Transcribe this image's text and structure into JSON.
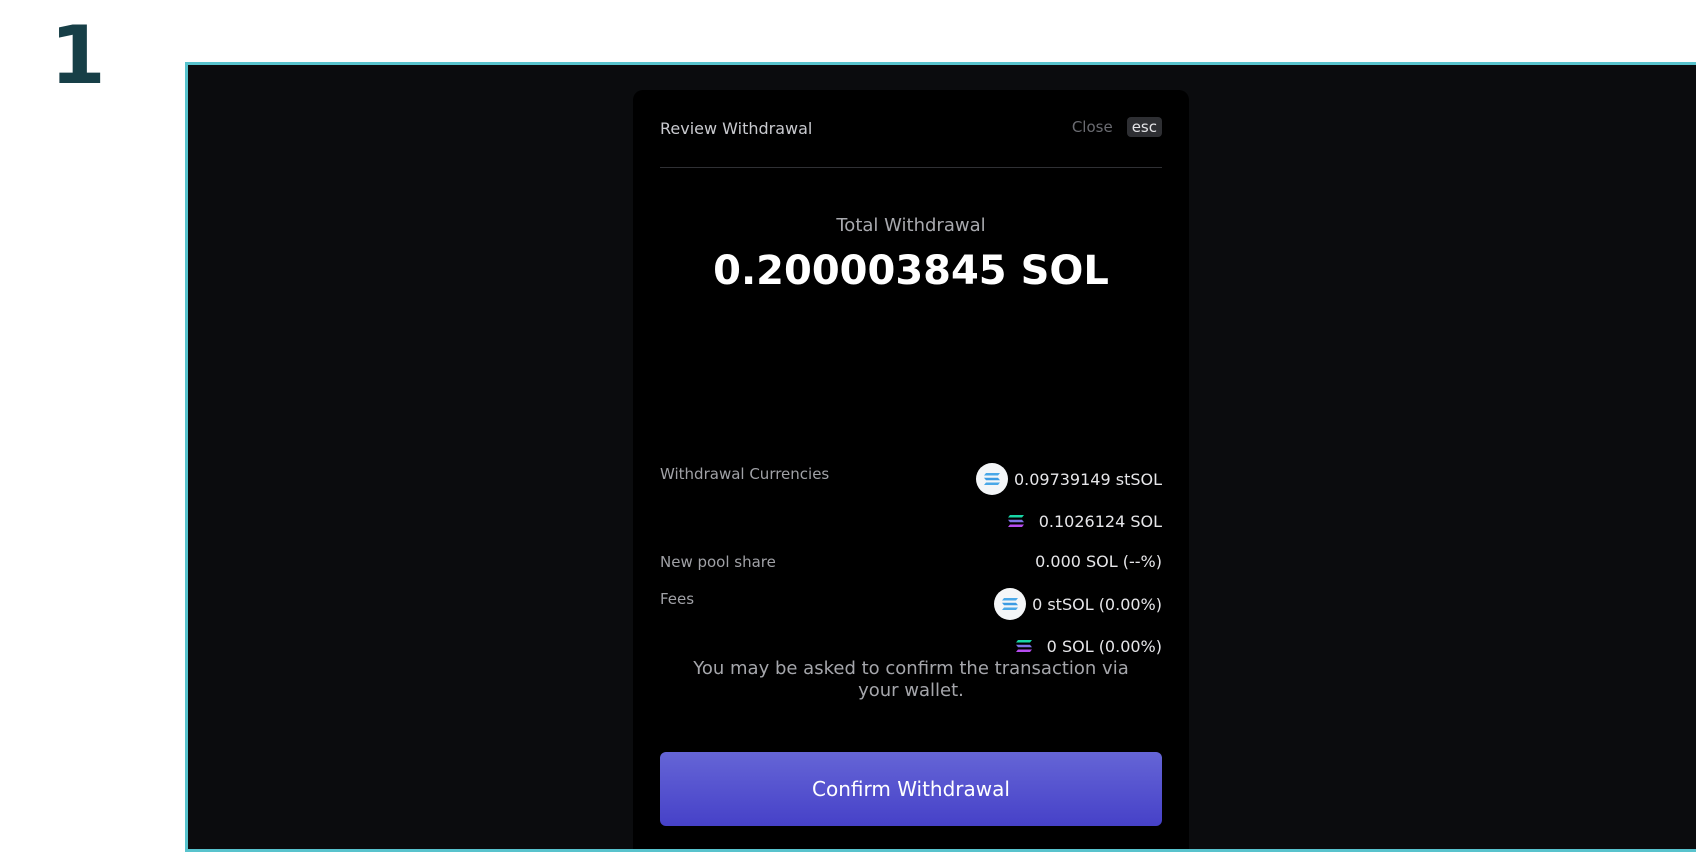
{
  "step_number": "1",
  "modal": {
    "title": "Review Withdrawal",
    "close_label": "Close",
    "esc_key": "esc",
    "total_label": "Total Withdrawal",
    "total_amount": "0.200003845 SOL",
    "withdrawal_currencies": {
      "label": "Withdrawal Currencies",
      "items": [
        {
          "icon": "stsol-coin-icon",
          "text": "0.09739149 stSOL"
        },
        {
          "icon": "sol-coin-icon",
          "text": "0.1026124 SOL"
        }
      ]
    },
    "pool_share": {
      "label": "New pool share",
      "value": "0.000 SOL (--%)"
    },
    "fees": {
      "label": "Fees",
      "items": [
        {
          "icon": "stsol-coin-icon",
          "text": "0 stSOL (0.00%)"
        },
        {
          "icon": "sol-coin-icon",
          "text": "0 SOL (0.00%)"
        }
      ]
    },
    "note": "You may be asked to confirm the transaction via your wallet.",
    "confirm_label": "Confirm Withdrawal"
  },
  "colors": {
    "accent": "#5552d0",
    "frame_border": "#58c3cd",
    "step_number": "#173f47"
  }
}
